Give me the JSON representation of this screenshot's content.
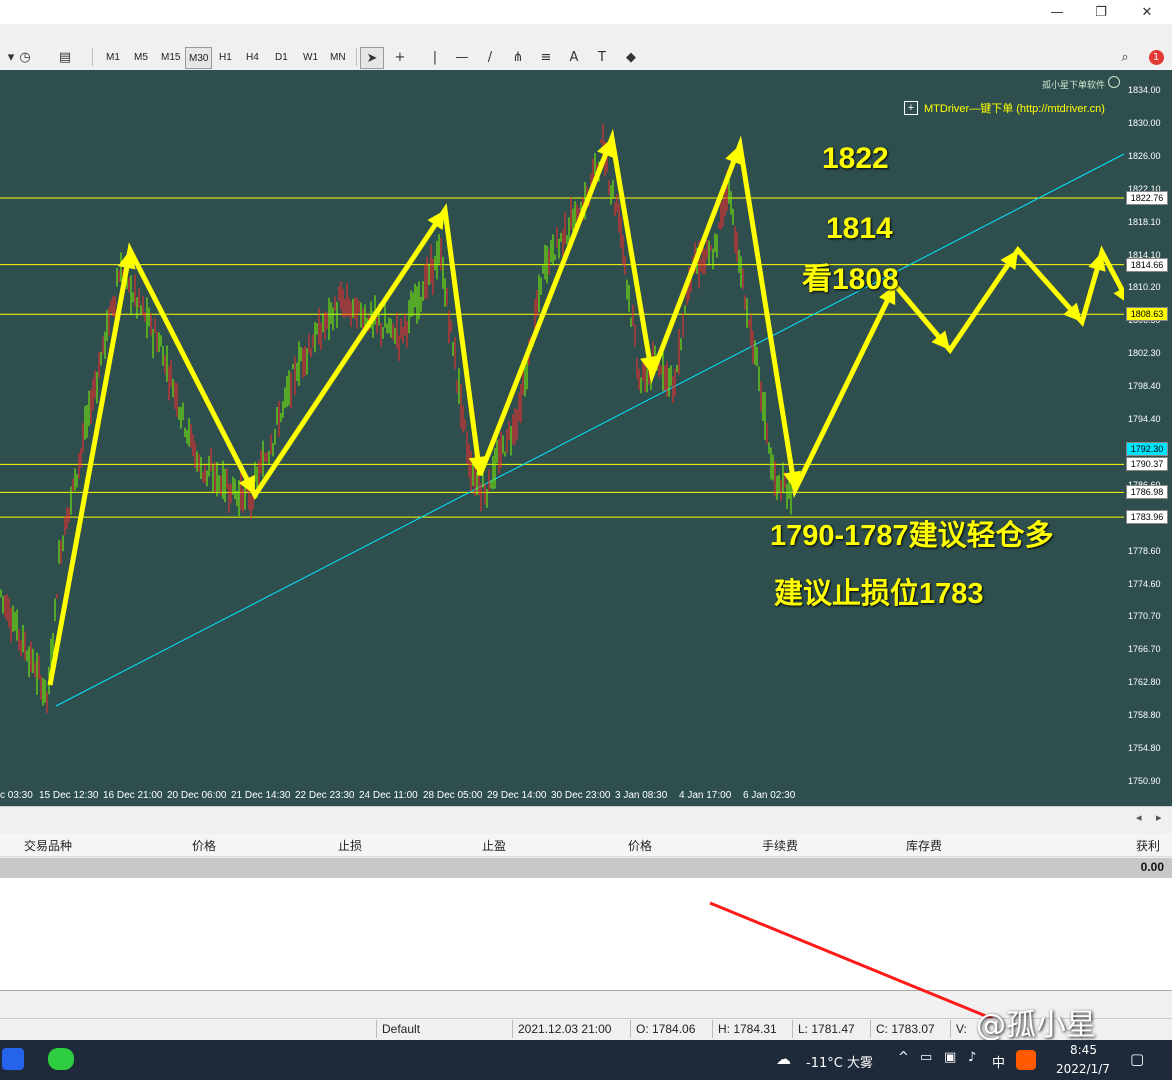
{
  "toolbar": {
    "timeframes": [
      {
        "label": "M1"
      },
      {
        "label": "M5"
      },
      {
        "label": "M15"
      },
      {
        "label": "M30",
        "active": true
      },
      {
        "label": "H1"
      },
      {
        "label": "H4"
      },
      {
        "label": "D1"
      },
      {
        "label": "W1"
      },
      {
        "label": "MN"
      }
    ],
    "tools": [
      {
        "name": "cursor-tool-icon",
        "glyph": "➤",
        "active": true
      },
      {
        "name": "crosshair-tool-icon",
        "glyph": "+"
      },
      {
        "name": "vertical-line-tool-icon",
        "glyph": "|"
      },
      {
        "name": "horizontal-line-tool-icon",
        "glyph": "—"
      },
      {
        "name": "trendline-tool-icon",
        "glyph": "/"
      },
      {
        "name": "pitchfork-tool-icon",
        "glyph": "⋔"
      },
      {
        "name": "fibonacci-tool-icon",
        "glyph": "≡"
      },
      {
        "name": "text-tool-icon",
        "glyph": "A"
      },
      {
        "name": "label-tool-icon",
        "glyph": "T"
      },
      {
        "name": "shapes-tool-icon",
        "glyph": "◆"
      }
    ],
    "notifications_count": "1"
  },
  "chart": {
    "watermark": "孤小星下单软件",
    "plugin_label": "MTDriver—键下单 (http://mtdriver.cn)",
    "y_labels": [
      "1834.00",
      "1830.00",
      "1826.00",
      "1822.10",
      "1818.10",
      "1814.10",
      "1810.20",
      "1806.30",
      "1802.30",
      "1798.40",
      "1794.40",
      "1790.50",
      "1786.60",
      "1782.50",
      "1778.60",
      "1774.60",
      "1770.70",
      "1766.70",
      "1762.80",
      "1758.80",
      "1754.80",
      "1750.90"
    ],
    "tags": [
      {
        "value": "1822.76",
        "bg": "#ffffff",
        "fg": "#000000"
      },
      {
        "value": "1814.66",
        "bg": "#ffffff",
        "fg": "#000000"
      },
      {
        "value": "1808.63",
        "bg": "#ffff00",
        "fg": "#000000"
      },
      {
        "value": "1792.30",
        "bg": "#00e5ff",
        "fg": "#000000"
      },
      {
        "value": "1790.37",
        "bg": "#ffffff",
        "fg": "#000000"
      },
      {
        "value": "1786.98",
        "bg": "#ffffff",
        "fg": "#000000"
      },
      {
        "value": "1783.96",
        "bg": "#ffffff",
        "fg": "#000000"
      }
    ],
    "x_labels": [
      "c 03:30",
      "15 Dec 12:30",
      "16 Dec 21:00",
      "20 Dec 06:00",
      "21 Dec 14:30",
      "22 Dec 23:30",
      "24 Dec 11:00",
      "28 Dec 05:00",
      "29 Dec 14:00",
      "30 Dec 23:00",
      "3 Jan 08:30",
      "4 Jan 17:00",
      "6 Jan 02:30"
    ],
    "annotations": {
      "a1822": "1822",
      "a1814": "1814",
      "a1808": "看1808",
      "entry": "1790-1787建议轻仓多",
      "stop": "建议止损位1783"
    },
    "colors": {
      "background": "#2f4f4f",
      "hline": "#ffff00",
      "trendline": "#00e5ff",
      "bull": "#7cfc00",
      "bear": "#ff2a2a"
    }
  },
  "orders_table": {
    "headers": [
      "交易品种",
      "价格",
      "止损",
      "止盈",
      "价格",
      "手续费",
      "库存费",
      "获利"
    ],
    "balance_profit": "0.00"
  },
  "status": {
    "profile": "Default",
    "datetime": "2021.12.03 21:00",
    "open": "O: 1784.06",
    "high": "H: 1784.31",
    "low": "L: 1781.47",
    "close": "C: 1783.07",
    "volume": "V:",
    "watermark": "@孤小星"
  },
  "taskbar": {
    "weather": "-11°C 大雾",
    "ime": "中",
    "time": "8:45",
    "date": "2022/1/7"
  }
}
